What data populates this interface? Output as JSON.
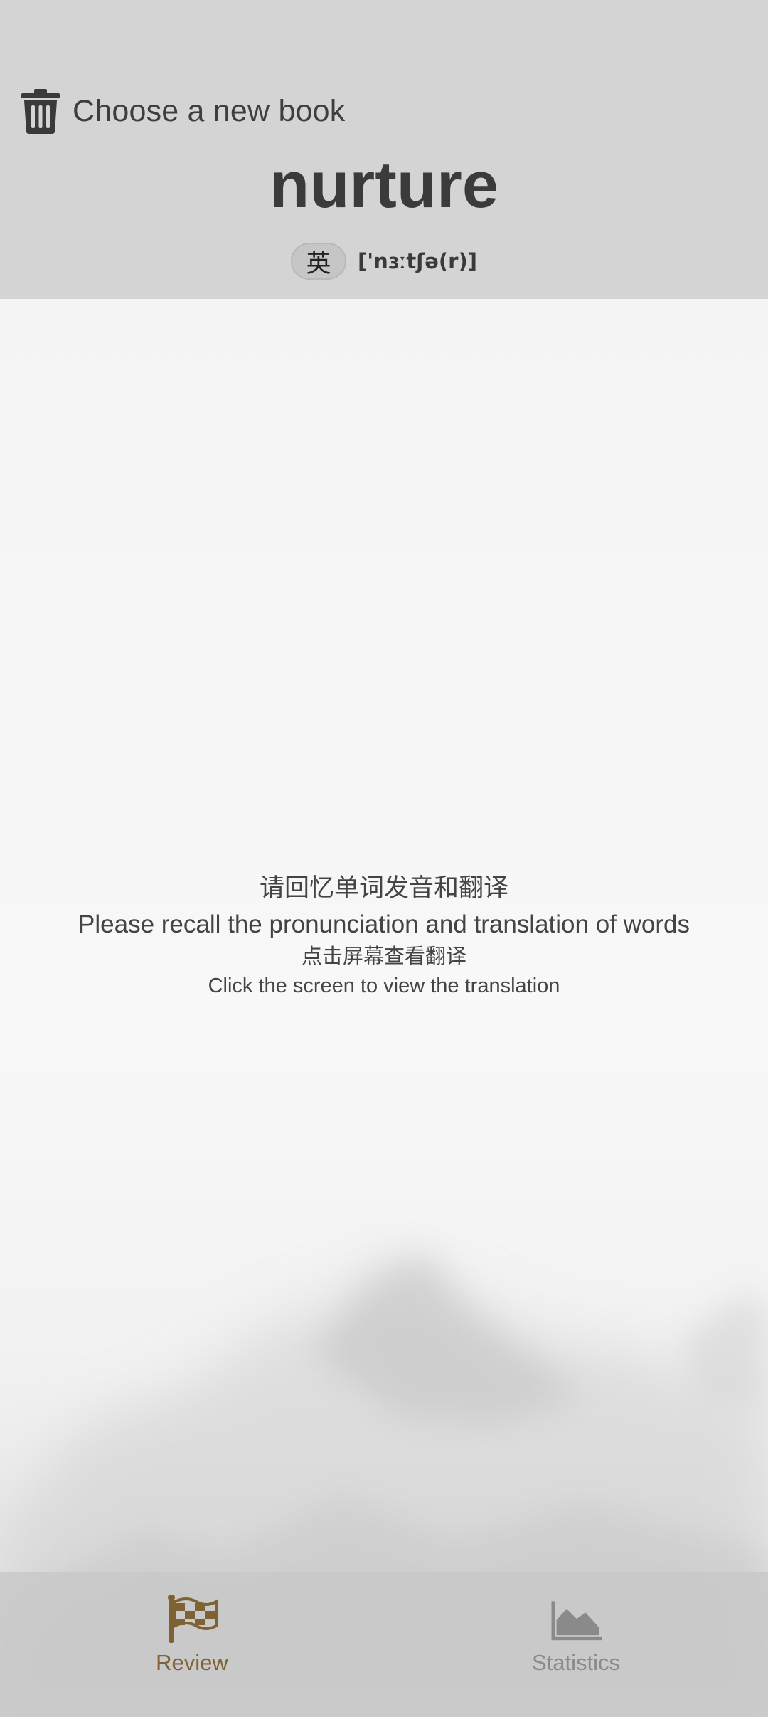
{
  "header": {
    "choose_book_label": "Choose a new book",
    "word": "nurture",
    "accent": "英",
    "phonetic": "['nɜːtʃə(r)]"
  },
  "prompt": {
    "recall_zh": "请回忆单词发音和翻译",
    "recall_en": "Please recall the pronunciation and translation of words",
    "tap_zh": "点击屏幕查看翻译",
    "tap_en": "Click the screen to view the translation"
  },
  "bottom_nav": {
    "items": [
      {
        "label": "Review",
        "icon": "checkered-flag-icon",
        "active": true
      },
      {
        "label": "Statistics",
        "icon": "area-chart-icon",
        "active": false
      }
    ]
  },
  "colors": {
    "header_bg": "#d4d4d4",
    "active_tab": "#7f6234",
    "inactive_tab": "#8a8a8a",
    "text_dark": "#3b3b3b"
  }
}
